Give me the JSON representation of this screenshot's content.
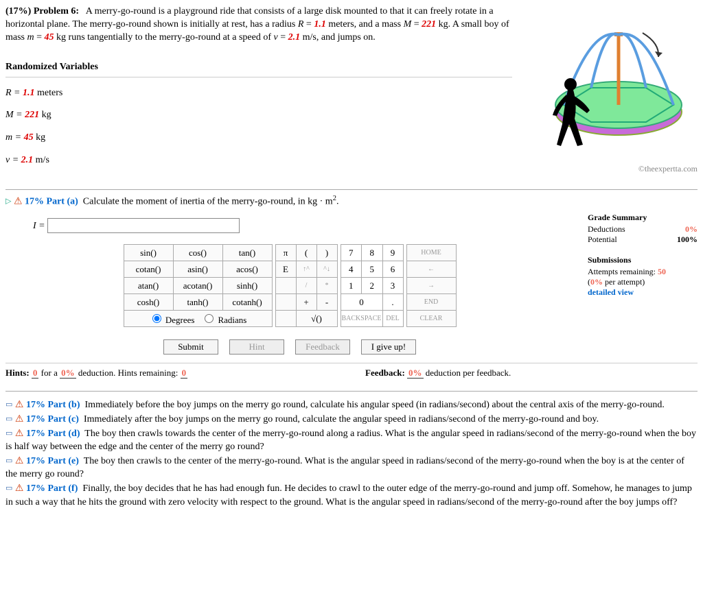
{
  "problem": {
    "weight": "(17%)",
    "label": "Problem 6:",
    "text_prefix": "A merry-go-round is a playground ride that consists of a large disk mounted to that it can freely rotate in a horizontal plane. The merry-go-round shown is initially at rest, has a radius ",
    "R_sym": "R",
    "R_val": "1.1",
    "R_unit": " meters, and a mass ",
    "M_sym": "M",
    "M_val": "221",
    "M_unit": " kg. A small boy of mass ",
    "m_sym": "m",
    "m_val": "45",
    "m_unit": " kg runs tangentially to the merry-go-round at a speed of ",
    "v_sym": "v",
    "v_val": "2.1",
    "v_unit": " m/s, and jumps on."
  },
  "copyright": "©theexpertta.com",
  "randomized": {
    "title": "Randomized Variables",
    "R_line_a": "R = ",
    "R_line_val": "1.1",
    "R_line_b": " meters",
    "M_line_a": "M = ",
    "M_line_val": "221",
    "M_line_b": " kg",
    "m_line_a": "m = ",
    "m_line_val": "45",
    "m_line_b": " kg",
    "v_line_a": "v = ",
    "v_line_val": "2.1",
    "v_line_b": " m/s"
  },
  "part_a": {
    "pct": "17%",
    "label": "Part (a)",
    "prompt_prefix": "Calculate the moment of inertia of the merry-go-round, in kg · m",
    "exponent": "2",
    "prompt_suffix": ".",
    "answer_label": "I = ",
    "answer_value": ""
  },
  "grade": {
    "title": "Grade Summary",
    "ded_label": "Deductions",
    "ded_val": "0%",
    "pot_label": "Potential",
    "pot_val": "100%"
  },
  "subs": {
    "title": "Submissions",
    "line1_a": "Attempts remaining: ",
    "line1_b": "50",
    "line2_a": "(",
    "line2_b": "0%",
    "line2_c": " per attempt)",
    "link": "detailed view"
  },
  "calc": {
    "funcs": [
      [
        "sin()",
        "cos()",
        "tan()"
      ],
      [
        "cotan()",
        "asin()",
        "acos()"
      ],
      [
        "atan()",
        "acotan()",
        "sinh()"
      ],
      [
        "cosh()",
        "tanh()",
        "cotanh()"
      ]
    ],
    "pi": "π",
    "lp": "(",
    "rp": ")",
    "E": "E",
    "up": "↑^",
    "down": "^↓",
    "slash": "/",
    "star": "*",
    "plus": "+",
    "minus": "-",
    "dot": ".",
    "sqrt": "√()",
    "nums": [
      "7",
      "8",
      "9",
      "4",
      "5",
      "6",
      "1",
      "2",
      "3",
      "0"
    ],
    "home": "HOME",
    "left": "←",
    "right": "→",
    "end": "END",
    "backspace": "BACKSPACE",
    "del": "DEL",
    "clear": "CLEAR",
    "degrees": "Degrees",
    "radians": "Radians"
  },
  "actions": {
    "submit": "Submit",
    "hint": "Hint",
    "feedback": "Feedback",
    "giveup": "I give up!"
  },
  "hints": {
    "label_a": "Hints: ",
    "val_a": "0",
    "label_b": " for a ",
    "val_b": "0%",
    "label_c": " deduction. Hints remaining: ",
    "val_c": "0",
    "fb_label": "Feedback: ",
    "fb_val": "0%",
    "fb_suffix": " deduction per feedback."
  },
  "parts": {
    "b": {
      "pct": "17%",
      "label": "Part (b)",
      "text": "Immediately before the boy jumps on the merry go round, calculate his angular speed (in radians/second) about the central axis of the merry-go-round."
    },
    "c": {
      "pct": "17%",
      "label": "Part (c)",
      "text": "Immediately after the boy jumps on the merry go round, calculate the angular speed in radians/second of the merry-go-round and boy."
    },
    "d": {
      "pct": "17%",
      "label": "Part (d)",
      "text": "The boy then crawls towards the center of the merry-go-round along a radius. What is the angular speed in radians/second of the merry-go-round when the boy is half way between the edge and the center of the merry go round?"
    },
    "e": {
      "pct": "17%",
      "label": "Part (e)",
      "text": "The boy then crawls to the center of the merry-go-round. What is the angular speed in radians/second of the merry-go-round when the boy is at the center of the merry go round?"
    },
    "f": {
      "pct": "17%",
      "label": "Part (f)",
      "text": "Finally, the boy decides that he has had enough fun. He decides to crawl to the outer edge of the merry-go-round and jump off. Somehow, he manages to jump in such a way that he hits the ground with zero velocity with respect to the ground. What is the angular speed in radians/second of the merry-go-round after the boy jumps off?"
    }
  }
}
